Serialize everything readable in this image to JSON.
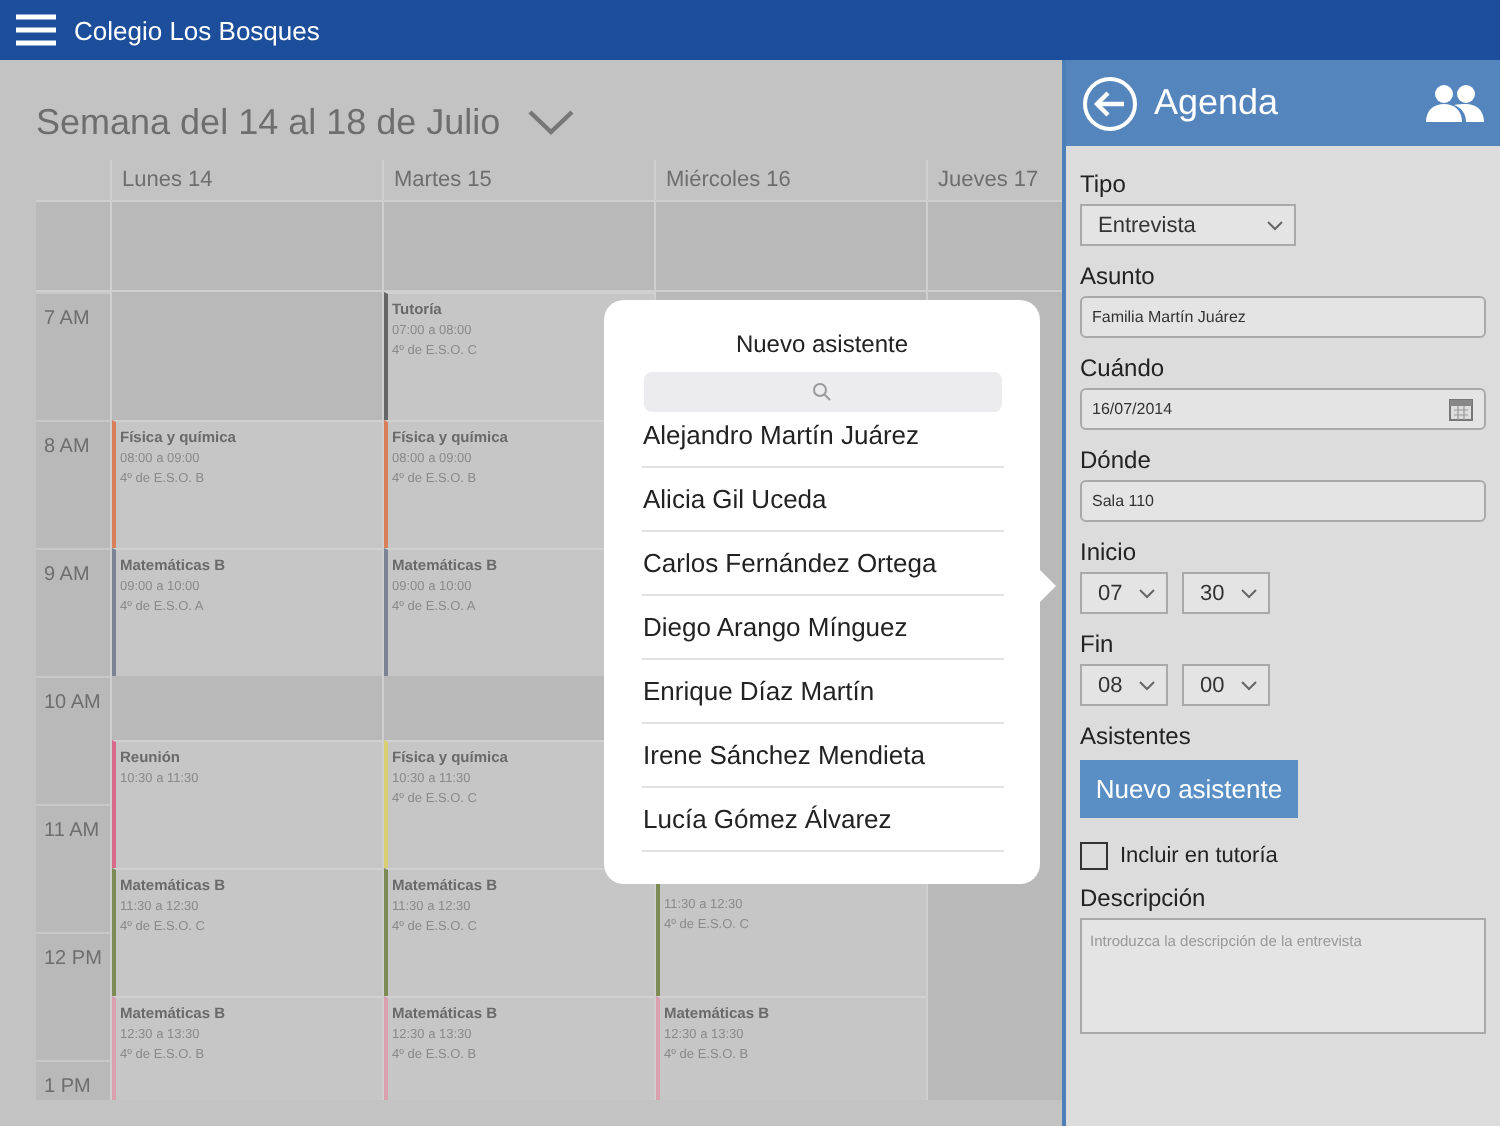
{
  "app_bar": {
    "title": "Colegio Los Bosques"
  },
  "calendar": {
    "week_title": "Semana del 14 al 18 de Julio",
    "hours": [
      "7 AM",
      "8 AM",
      "9 AM",
      "10 AM",
      "11 AM",
      "12 PM",
      "1 PM"
    ],
    "days": [
      {
        "label": "Lunes 14",
        "events": [
          {
            "title": "Física y química",
            "time": "08:00 a 09:00",
            "group": "4º de E.S.O. B",
            "color": "#d9805a"
          },
          {
            "title": "Matemáticas B",
            "time": "09:00 a 10:00",
            "group": "4º de E.S.O. A",
            "color": "#7a8494"
          },
          {
            "title": "Reunión",
            "time": "10:30 a 11:30",
            "color": "#d96a8c"
          },
          {
            "title": "Matemáticas B",
            "time": "11:30 a 12:30",
            "group": "4º de E.S.O. C",
            "color": "#7d8a55"
          },
          {
            "title": "Matemáticas B",
            "time": "12:30 a 13:30",
            "group": "4º de E.S.O. B",
            "color": "#d9a0b0"
          }
        ]
      },
      {
        "label": "Martes 15",
        "events": [
          {
            "title": "Tutoría",
            "time": "07:00 a 08:00",
            "group": "4º de E.S.O. C",
            "color": "#666666"
          },
          {
            "title": "Física y química",
            "time": "08:00 a 09:00",
            "group": "4º de E.S.O. B",
            "color": "#d9805a"
          },
          {
            "title": "Matemáticas B",
            "time": "09:00 a 10:00",
            "group": "4º de E.S.O. A",
            "color": "#7a8494"
          },
          {
            "title": "Física y química",
            "time": "10:30 a 11:30",
            "group": "4º de E.S.O. C",
            "color": "#d8d070"
          },
          {
            "title": "Matemáticas B",
            "time": "11:30 a 12:30",
            "group": "4º de E.S.O. C",
            "color": "#7d8a55"
          },
          {
            "title": "Matemáticas B",
            "time": "12:30 a 13:30",
            "group": "4º de E.S.O. B",
            "color": "#d9a0b0"
          }
        ]
      },
      {
        "label": "Miércoles 16",
        "events": [
          {
            "time": "11:30 a 12:30",
            "group": "4º de E.S.O. C",
            "color": "#7d8a55"
          },
          {
            "title": "Matemáticas B",
            "time": "12:30 a 13:30",
            "group": "4º de E.S.O. B",
            "color": "#d9a0b0"
          }
        ]
      },
      {
        "label": "Jueves 17"
      }
    ]
  },
  "popover": {
    "title": "Nuevo asistente",
    "people": [
      "Alejandro Martín Juárez",
      "Alicia Gil Uceda",
      "Carlos Fernández Ortega",
      "Diego Arango Mínguez",
      "Enrique Díaz Martín",
      "Irene Sánchez Mendieta",
      "Lucía Gómez Álvarez"
    ]
  },
  "panel": {
    "title": "Agenda",
    "fields": [
      {
        "kind": "select",
        "label": "Tipo",
        "value": "Entrevista"
      },
      {
        "kind": "text",
        "label": "Asunto",
        "value": "Familia Martín Juárez"
      },
      {
        "kind": "date",
        "label": "Cuándo",
        "value": "16/07/2014"
      },
      {
        "kind": "text",
        "label": "Dónde",
        "value": "Sala 110"
      },
      {
        "kind": "time",
        "label": "Inicio",
        "hour": "07",
        "minute": "30"
      },
      {
        "kind": "time",
        "label": "Fin",
        "hour": "08",
        "minute": "00"
      },
      {
        "kind": "button",
        "label": "Asistentes",
        "button": "Nuevo asistente"
      },
      {
        "kind": "checkbox",
        "label": "Incluir en tutoría",
        "checked": false
      },
      {
        "kind": "textarea",
        "label": "Descripción",
        "placeholder": "Introduzca la descripción de la entrevista"
      }
    ]
  }
}
